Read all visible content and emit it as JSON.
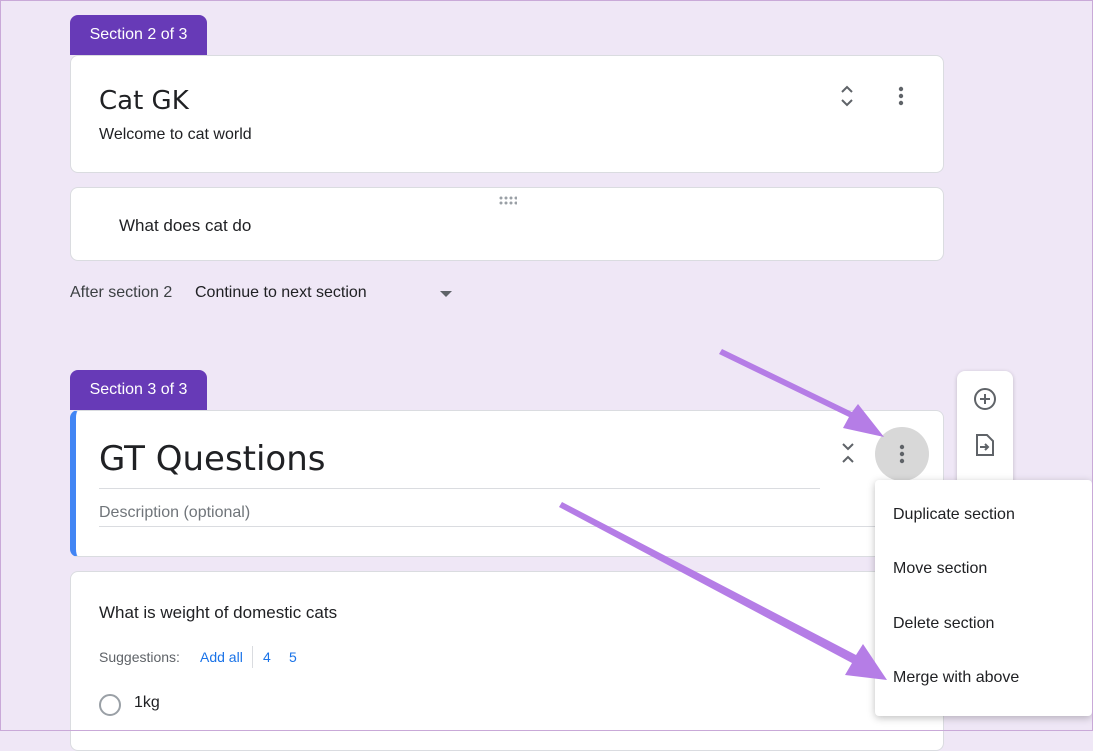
{
  "section2": {
    "tab_label": "Section 2 of 3",
    "title": "Cat GK",
    "description": "Welcome to cat world",
    "question": "What does cat do",
    "after_label": "After section 2",
    "after_value": "Continue to next section"
  },
  "section3": {
    "tab_label": "Section 3 of 3",
    "title": "GT Questions",
    "description_placeholder": "Description (optional)",
    "question": "What is weight of domestic cats",
    "suggestions_label": "Suggestions:",
    "suggestions_add_all": "Add all",
    "suggestions": [
      "4",
      "5"
    ],
    "option1": "1kg"
  },
  "menu": {
    "items": [
      "Duplicate section",
      "Move section",
      "Delete section",
      "Merge with above"
    ]
  },
  "colors": {
    "accent": "#673ab7",
    "active_border": "#4285f4",
    "background": "#efe7f6",
    "arrow": "#b57de6",
    "link": "#1a73e8"
  },
  "icons": [
    "collapse-icon",
    "more-vert-icon",
    "drag-handle-icon",
    "dropdown-arrow-icon",
    "add-circle-icon",
    "import-questions-icon"
  ]
}
